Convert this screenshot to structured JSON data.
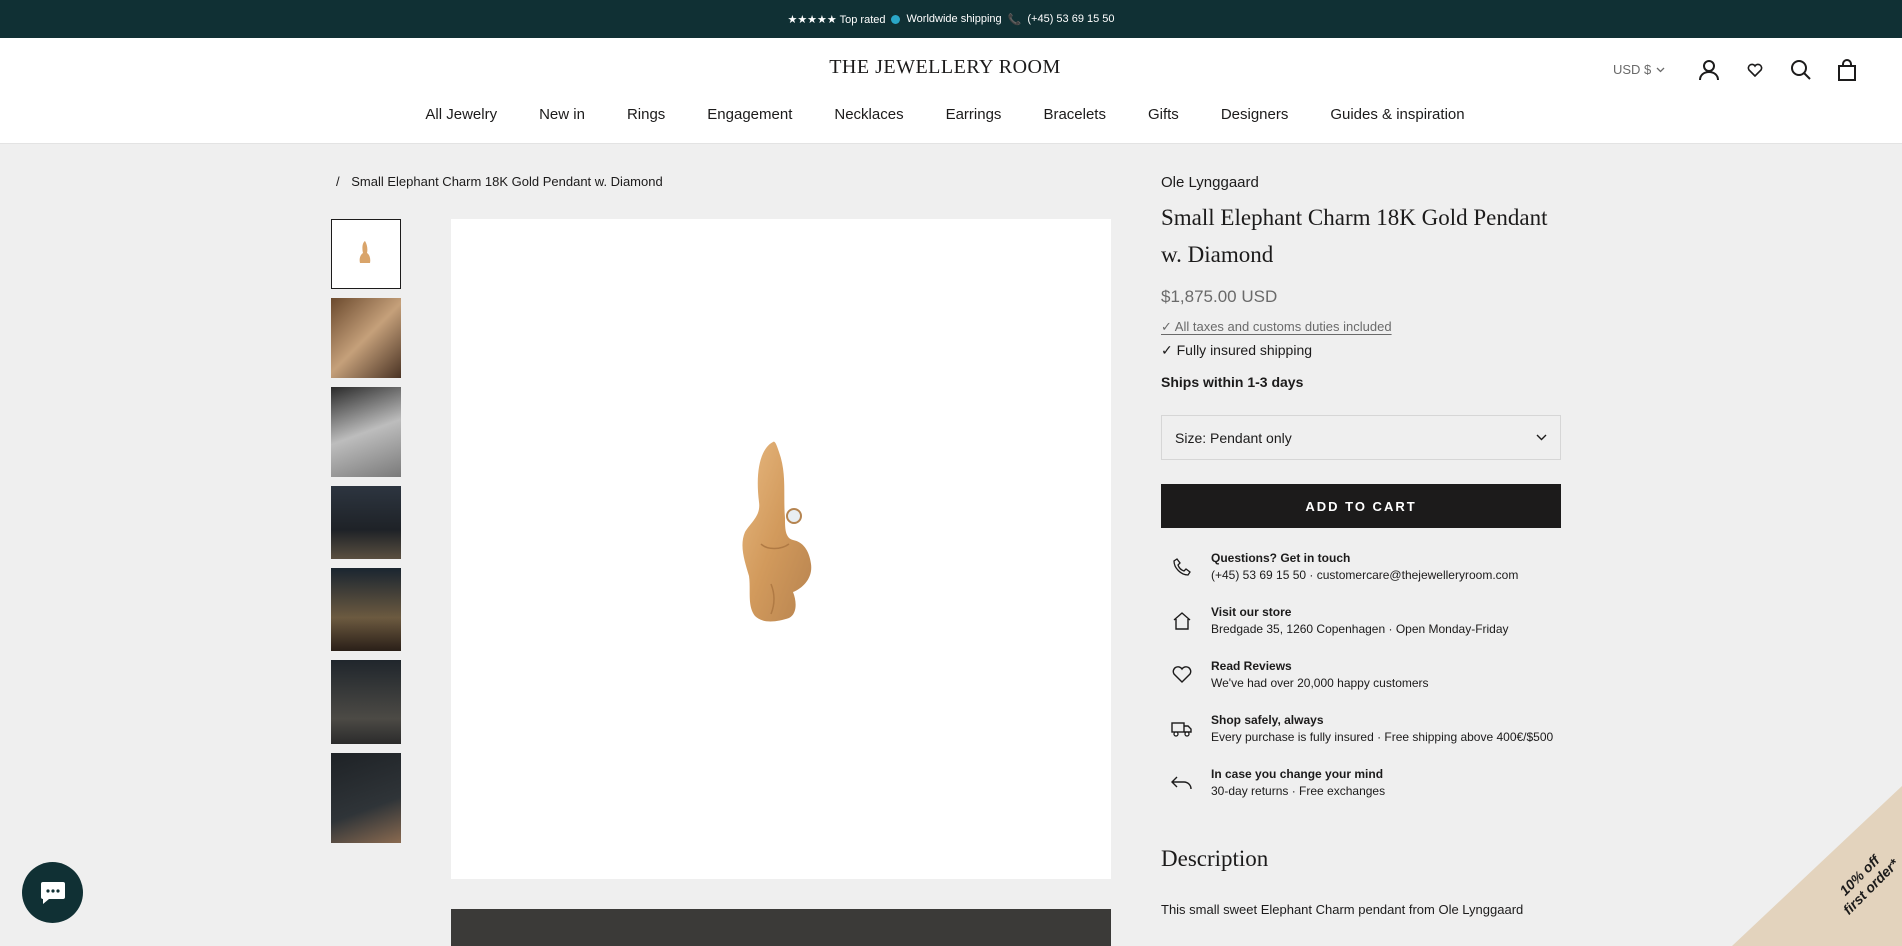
{
  "announcement": {
    "rated": "★★★★★ Top rated",
    "shipping": "Worldwide shipping",
    "phone": "(+45) 53 69 15 50"
  },
  "header": {
    "logo": "THE JEWELLERY ROOM",
    "currency": "USD $",
    "nav": [
      "All Jewelry",
      "New in",
      "Rings",
      "Engagement",
      "Necklaces",
      "Earrings",
      "Bracelets",
      "Gifts",
      "Designers",
      "Guides & inspiration"
    ]
  },
  "breadcrumb": {
    "separator": "/",
    "current": "Small Elephant Charm 18K Gold Pendant w. Diamond"
  },
  "product": {
    "brand": "Ole Lynggaard",
    "title": "Small Elephant Charm 18K Gold Pendant w. Diamond",
    "price": "$1,875.00 USD",
    "taxes": "✓ All taxes and customs duties included",
    "insured": "✓ Fully insured shipping",
    "ships": "Ships within 1-3 days",
    "size_label": "Size: Pendant only",
    "add_to_cart": "ADD TO CART"
  },
  "features": [
    {
      "title": "Questions? Get in touch",
      "desc": "(+45) 53 69 15 50 · customercare@thejewelleryroom.com"
    },
    {
      "title": "Visit our store",
      "desc": "Bredgade 35, 1260 Copenhagen · Open Monday-Friday"
    },
    {
      "title": "Read Reviews",
      "desc": "We've had over 20,000 happy customers"
    },
    {
      "title": "Shop safely, always",
      "desc": "Every purchase is fully insured · Free shipping above 400€/$500"
    },
    {
      "title": "In case you change your mind",
      "desc": "30-day returns · Free exchanges"
    }
  ],
  "description": {
    "heading": "Description",
    "text": "This small sweet Elephant Charm pendant from Ole Lynggaard"
  },
  "promo": {
    "line1": "10% off",
    "line2": "first order*"
  },
  "colors": {
    "announcement_bg": "#103034",
    "button_bg": "#1c1b1b",
    "page_bg": "#efefef",
    "promo_bg": "#e3d3bd"
  }
}
